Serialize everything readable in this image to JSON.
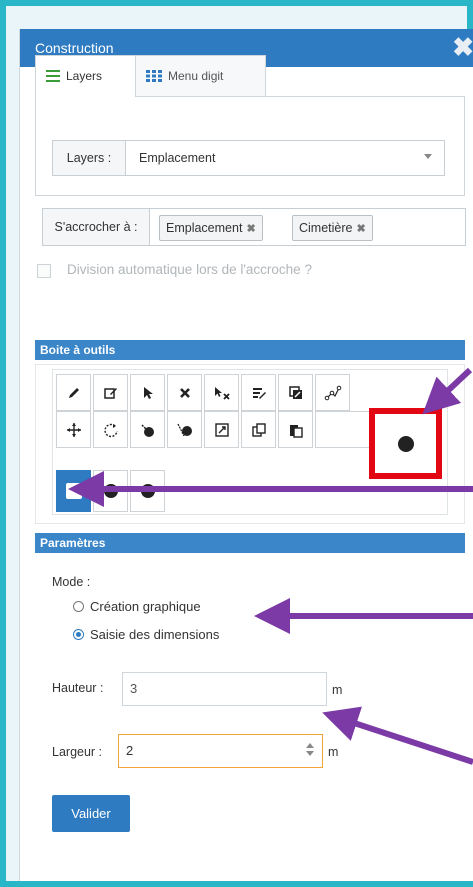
{
  "window": {
    "title": "Construction",
    "close_glyph": "✖"
  },
  "tabs": [
    {
      "label": "Layers",
      "icon": "list-icon",
      "active": true
    },
    {
      "label": "Menu digit",
      "icon": "grid-icon",
      "active": false
    }
  ],
  "layers": {
    "label": "Layers :",
    "value": "Emplacement"
  },
  "snap": {
    "label": "S'accrocher à :",
    "chips": [
      {
        "label": "Emplacement"
      },
      {
        "label": "Cimetière"
      }
    ],
    "remove_glyph": "✖"
  },
  "auto_split": {
    "label": "Division automatique lors de l'accroche ?",
    "checked": false
  },
  "toolbox": {
    "title": "Boite à outils",
    "tools": [
      {
        "name": "draw-pencil-icon"
      },
      {
        "name": "edit-icon"
      },
      {
        "name": "select-pointer-icon"
      },
      {
        "name": "delete-x-icon"
      },
      {
        "name": "pointer-delete-icon"
      },
      {
        "name": "edit-attributes-icon"
      },
      {
        "name": "copy-attributes-icon"
      },
      {
        "name": "vertex-edit-icon"
      },
      {
        "name": "move-icon"
      },
      {
        "name": "rotate-icon"
      },
      {
        "name": "merge-icon"
      },
      {
        "name": "split-icon"
      },
      {
        "name": "resize-icon"
      },
      {
        "name": "duplicate-icon"
      },
      {
        "name": "paste-icon"
      },
      {
        "name": "circle-icon"
      },
      {
        "name": "rectangle-icon"
      },
      {
        "name": "circle-tool-icon"
      },
      {
        "name": "circle-outline-icon"
      }
    ],
    "selected_tool": "rectangle-icon",
    "highlighted_tool": "circle-icon"
  },
  "params": {
    "title": "Paramètres",
    "mode_label": "Mode :",
    "modes": [
      {
        "label": "Création graphique",
        "selected": false
      },
      {
        "label": "Saisie des dimensions",
        "selected": true
      }
    ],
    "height_label": "Hauteur :",
    "height_value": "3",
    "height_unit": "m",
    "width_label": "Largeur :",
    "width_value": "2",
    "width_unit": "m",
    "submit_label": "Valider"
  },
  "colors": {
    "accent": "#2f7bc2",
    "frame": "#29b6c6",
    "annotation_arrow": "#7b3aa6",
    "annotation_box": "#e30613",
    "focus": "#f0a43a"
  }
}
